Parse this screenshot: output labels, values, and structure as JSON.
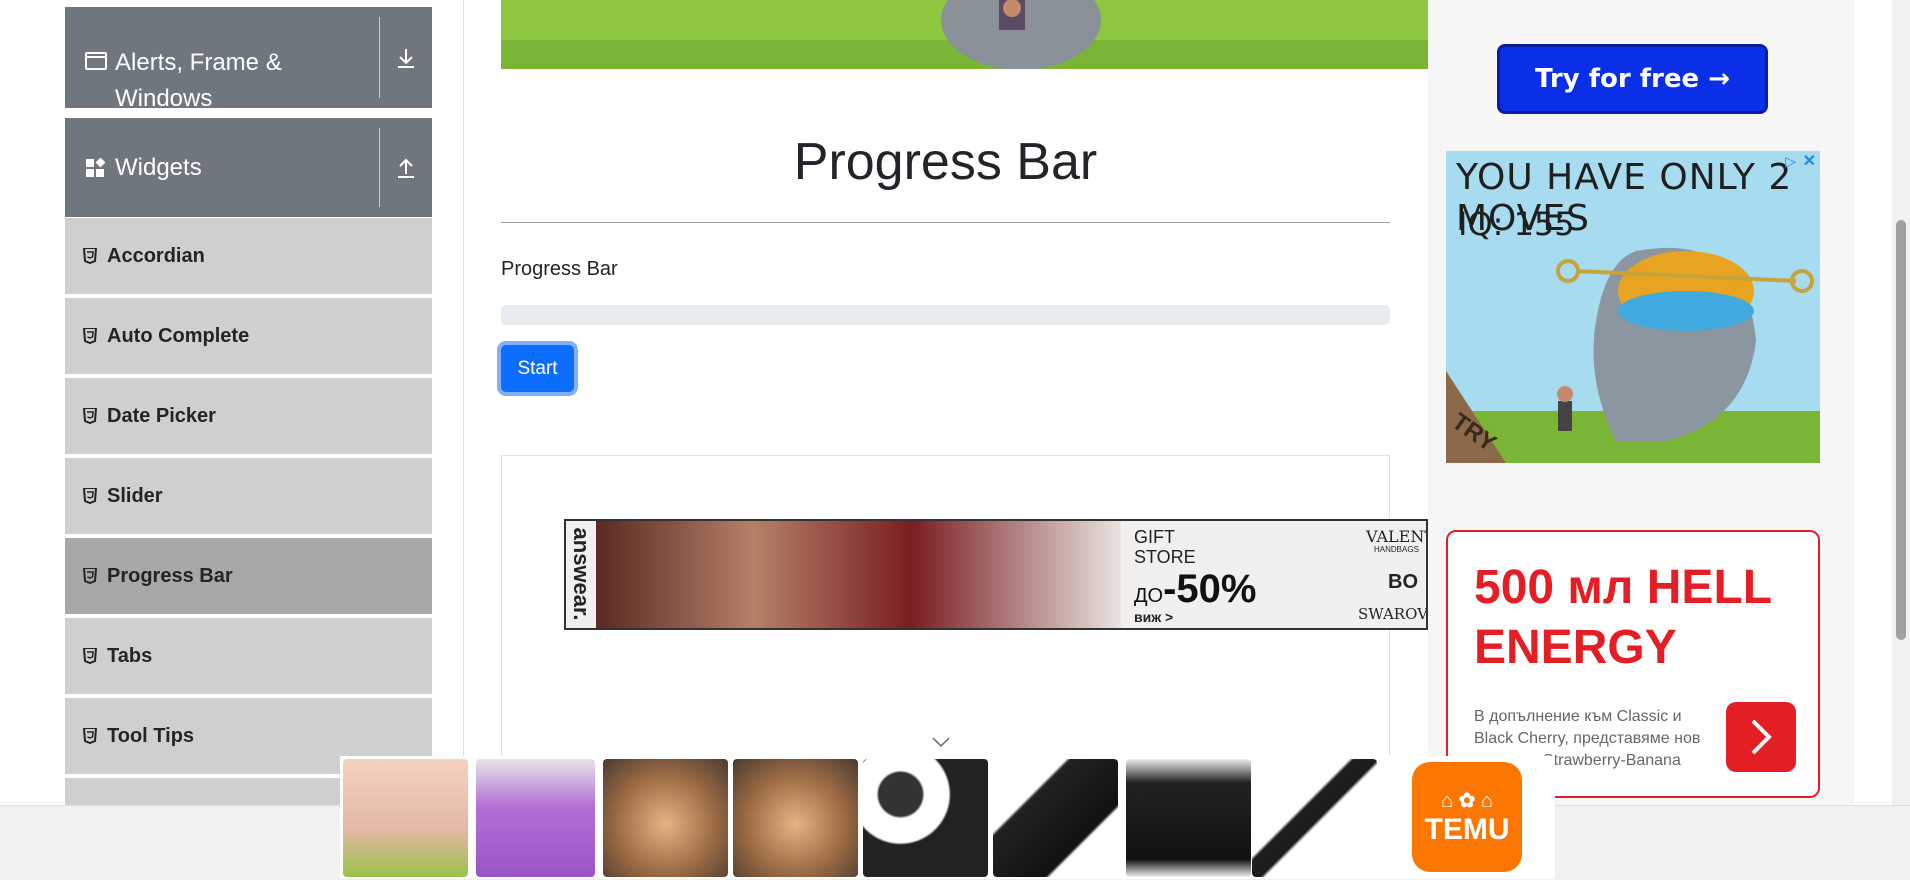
{
  "sidebar": {
    "groups": [
      {
        "label": "Alerts, Frame & Windows",
        "toggle_icon": "download-icon"
      },
      {
        "label": "Widgets",
        "toggle_icon": "upload-icon"
      }
    ],
    "items": [
      {
        "label": "Accordian"
      },
      {
        "label": "Auto Complete"
      },
      {
        "label": "Date Picker"
      },
      {
        "label": "Slider"
      },
      {
        "label": "Progress Bar",
        "active": true
      },
      {
        "label": "Tabs"
      },
      {
        "label": "Tool Tips"
      }
    ]
  },
  "main": {
    "title": "Progress Bar",
    "progress_label": "Progress Bar",
    "progress_value": 0,
    "start_button": "Start",
    "banner_ad": {
      "brand": "answear.",
      "line1": "GIFT",
      "line2": "STORE",
      "prefix": "ДО",
      "discount": "-50%",
      "cta": "виж >",
      "brand2": "VALENTI",
      "brand2_sub": "HANDBAGS",
      "brand3": "BO",
      "brand4": "SWAROV"
    }
  },
  "ads": {
    "try_button": "Try for free →",
    "game_headline": "YOU HAVE ONLY 2 MOVES",
    "game_iq": "IQ: 155",
    "game_corner": "TRY",
    "energy_headline": "500 мл HELL ENERGY",
    "energy_desc": "В допълнение към Classic и Black Cherry, представяме нов вариант: Strawberry-Banana",
    "temu_label": "TEMU"
  },
  "colors": {
    "sidebar_header": "#6f767e",
    "menu_item": "#cfcfcf",
    "menu_item_active": "#a8a8a8",
    "primary_button": "#0d6efd",
    "energy_red": "#e31e24",
    "temu_orange": "#fb7701"
  }
}
